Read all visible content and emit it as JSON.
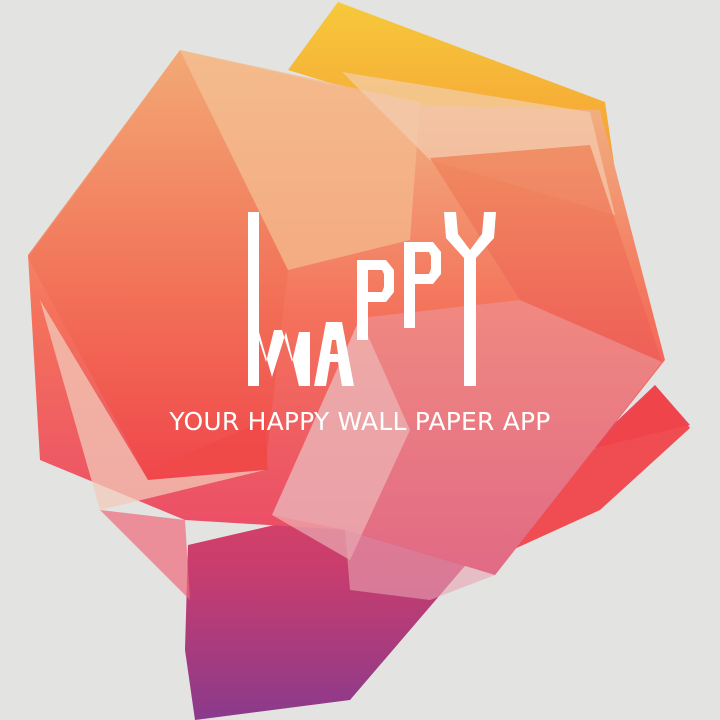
{
  "splash": {
    "logo_text": "WAPPY",
    "tagline": "YOUR HAPPY WALL PAPER APP"
  },
  "colors": {
    "background": "#e3e3e1",
    "text": "#ffffff",
    "yellow": "#f6c93a",
    "orange": "#f5923a",
    "coral": "#f2735c",
    "red": "#f0454a",
    "pink": "#e98a92",
    "magenta": "#c53d6d",
    "purple": "#8f3b8a"
  }
}
